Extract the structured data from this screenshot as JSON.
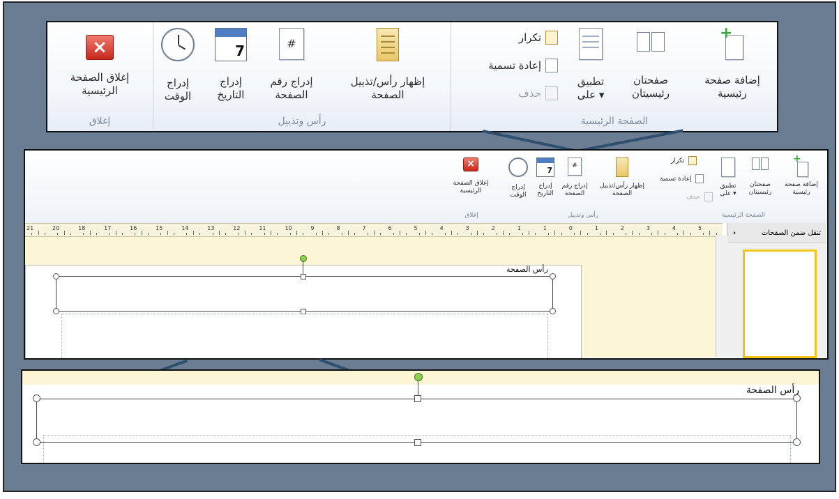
{
  "ribbon": {
    "groups": {
      "close": {
        "label": "إغلاق"
      },
      "header_footer": {
        "label": "رأس وتذييل"
      },
      "master_page": {
        "label": "الصفحة الرئيسية"
      }
    },
    "buttons": {
      "close_master": {
        "line1": "إغلاق الصفحة",
        "line2": "الرئيسية"
      },
      "insert_time": {
        "line1": "إدراج",
        "line2": "الوقت"
      },
      "insert_date": {
        "line1": "إدراج",
        "line2": "التاريخ"
      },
      "insert_page_number": {
        "line1": "إدراج رقم",
        "line2": "الصفحة"
      },
      "show_header_footer": {
        "line1": "إظهار رأس/تذييل",
        "line2": "الصفحة"
      },
      "duplicate": "تكرار",
      "rename": "إعادة تسمية",
      "delete": "حذف",
      "apply_to": {
        "line1": "تطبيق",
        "line2": "على ▾"
      },
      "two_masters": {
        "line1": "صفحتان",
        "line2": "رئيسيتان"
      },
      "add_master": {
        "line1": "إضافة صفحة",
        "line2": "رئيسية"
      }
    },
    "calendar_number": "7",
    "page_number_symbol": "#",
    "close_symbol": "×"
  },
  "ruler": {
    "numbers": [
      "21",
      "20",
      "18",
      "17",
      "16",
      "15",
      "14",
      "13",
      "12",
      "11",
      "10",
      "9",
      "8",
      "7",
      "6",
      "5",
      "4",
      "3",
      "2",
      "1",
      "1",
      "0",
      "1",
      "2",
      "3",
      "4",
      "5"
    ]
  },
  "nav_pane": {
    "title": "تنقل ضمن الصفحات",
    "collapse_symbol": "‹"
  },
  "document": {
    "header_label": "رأس الصفحة"
  },
  "colors": {
    "frame_bg": "#6b7d93",
    "connector": "#2f4f6e",
    "page_bg_yellow": "#fdf6d6",
    "selected_thumb": "#f0c419"
  }
}
